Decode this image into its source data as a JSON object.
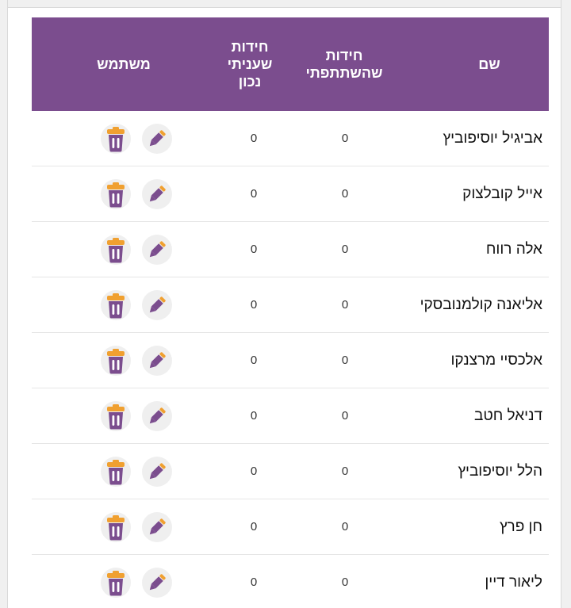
{
  "table": {
    "columns": {
      "name": "שם",
      "participated": "חידות שהשתתפתי",
      "correct": "חידות שעניתי נכון",
      "user": "משתמש"
    },
    "rows": [
      {
        "name": "אביגיל יוסיפוביץ",
        "participated": "0",
        "correct": "0"
      },
      {
        "name": "אייל קובלצוק",
        "participated": "0",
        "correct": "0"
      },
      {
        "name": "אלה רווח",
        "participated": "0",
        "correct": "0"
      },
      {
        "name": "אליאנה קולמנובסקי",
        "participated": "0",
        "correct": "0"
      },
      {
        "name": "אלכסיי מרצנקו",
        "participated": "0",
        "correct": "0"
      },
      {
        "name": "דניאל חטב",
        "participated": "0",
        "correct": "0"
      },
      {
        "name": "הלל יוסיפוביץ",
        "participated": "0",
        "correct": "0"
      },
      {
        "name": "חן פרץ",
        "participated": "0",
        "correct": "0"
      },
      {
        "name": "ליאור דיין",
        "participated": "0",
        "correct": "0"
      }
    ]
  },
  "icons": {
    "edit": "pencil-icon",
    "delete": "trash-icon"
  },
  "colors": {
    "header_bg": "#7b4d8e",
    "icon_purple": "#7b4d8e",
    "icon_orange": "#f0a030",
    "edit_bg": "#efefef"
  }
}
